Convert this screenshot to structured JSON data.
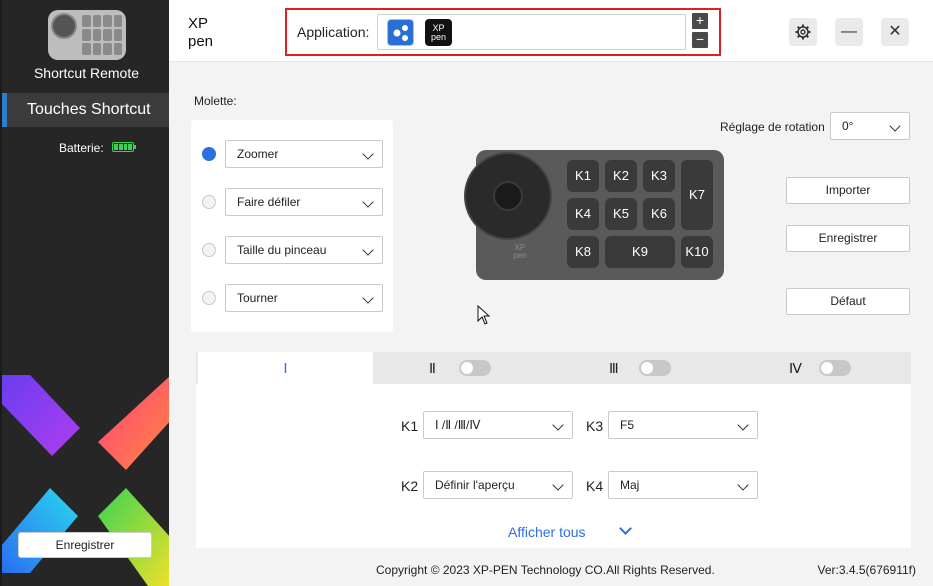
{
  "sidebar": {
    "device_name": "Shortcut Remote",
    "active_item": "Touches Shortcut",
    "battery_label": "Batterie:",
    "save_button": "Enregistrer"
  },
  "header": {
    "application_label": "Application:",
    "app_icons": [
      "blue-app-icon",
      "xppen-app-icon"
    ],
    "xppen_logo_text": "XP pen",
    "plus": "+",
    "minus": "−",
    "settings_icon": "gear-icon",
    "minimize": "—",
    "close": "✕"
  },
  "molette": {
    "label": "Molette:",
    "options": [
      {
        "value": "Zoomer",
        "selected": true
      },
      {
        "value": "Faire défiler",
        "selected": false
      },
      {
        "value": "Taille du pinceau",
        "selected": false
      },
      {
        "value": "Tourner",
        "selected": false
      }
    ]
  },
  "device": {
    "logo": "XP pen",
    "keys": [
      "K1",
      "K2",
      "K3",
      "K4",
      "K5",
      "K6",
      "K7",
      "K8",
      "K9",
      "K10"
    ]
  },
  "rotation": {
    "label": "Réglage de rotation",
    "value": "0°"
  },
  "actions": {
    "import": "Importer",
    "save": "Enregistrer",
    "default": "Défaut"
  },
  "tabs": [
    {
      "label": "Ⅰ",
      "active": true
    },
    {
      "label": "Ⅱ",
      "toggle": false
    },
    {
      "label": "Ⅲ",
      "toggle": false
    },
    {
      "label": "Ⅳ",
      "toggle": false
    }
  ],
  "key_settings": [
    {
      "key": "K1",
      "value": "Ⅰ /Ⅱ /Ⅲ/Ⅳ"
    },
    {
      "key": "K3",
      "value": "F5"
    },
    {
      "key": "K2",
      "value": "Définir l'aperçu"
    },
    {
      "key": "K4",
      "value": "Maj"
    }
  ],
  "show_all": "Afficher tous",
  "footer": {
    "copyright": "Copyright © 2023  XP-PEN Technology CO.All Rights Reserved.",
    "version": "Ver:3.4.5(676911f)"
  },
  "colors": {
    "accent": "#2c6fe0",
    "highlight_border": "#e02020",
    "sidebar_bg": "#262626"
  }
}
